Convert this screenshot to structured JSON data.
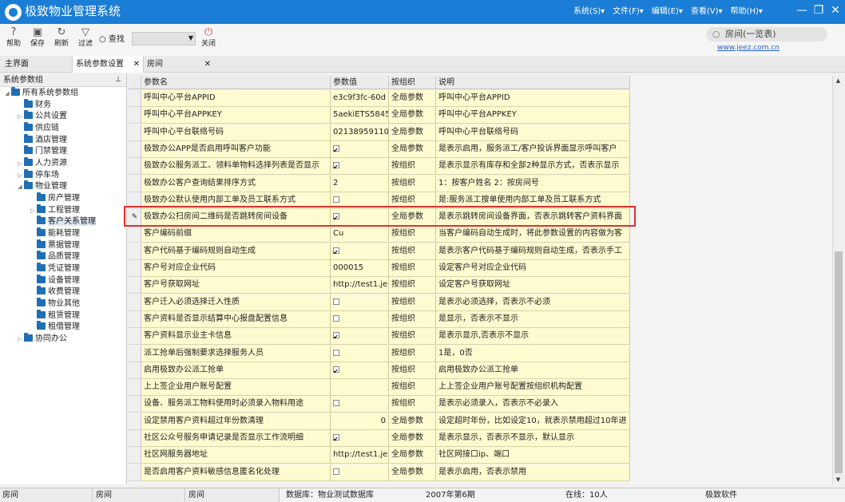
{
  "window": {
    "title": "极致物业管理系统",
    "menu": [
      "系统(S)▾",
      "文件(F)▾",
      "编辑(E)▾",
      "查看(V)▾",
      "帮助(H)▾"
    ]
  },
  "toolbar": {
    "help": "帮助",
    "save": "保存",
    "refresh": "刷新",
    "filter": "过滤",
    "search": "查找",
    "close": "关闭",
    "top_search": "房间(一览表)",
    "site": "www.jeez.com.cn"
  },
  "tabs": {
    "main": "主界面",
    "params": "系统参数设置",
    "room": "房间"
  },
  "tree": {
    "header": "系统参数组",
    "root": "所有系统参数组",
    "items": [
      "财务",
      "公共设置",
      "供应链",
      "酒店管理",
      "门禁管理",
      "人力资源",
      "停车场",
      "物业管理"
    ],
    "sub_items": [
      "房产管理",
      "工程管理",
      "客户关系管理",
      "能耗管理",
      "票据管理",
      "品质管理",
      "凭证管理",
      "设备管理",
      "收费管理",
      "物业其他",
      "租赁管理",
      "租借管理"
    ],
    "last": "协同办公"
  },
  "grid": {
    "headers": [
      "参数名",
      "参数值",
      "按组织",
      "说明"
    ],
    "rows": [
      {
        "name": "呼叫中心平台APPID",
        "value": "e3c9f3fc-60d",
        "check": null,
        "scope": "全局参数",
        "desc": "呼叫中心平台APPID"
      },
      {
        "name": "呼叫中心平台APPKEY",
        "value": "5aekiETS5845",
        "check": null,
        "scope": "全局参数",
        "desc": "呼叫中心平台APPKEY"
      },
      {
        "name": "呼叫中心平台联络号码",
        "value": "02138959110",
        "check": null,
        "scope": "全局参数",
        "desc": "呼叫中心平台联络号码"
      },
      {
        "name": "极致办公APP是否启用呼叫客户功能",
        "value": "",
        "check": true,
        "scope": "全局参数",
        "desc": "是表示启用，服务派工/客户投诉界面显示呼叫客户"
      },
      {
        "name": "极致办公服务派工、领料单物料选择列表是否显示",
        "value": "",
        "check": true,
        "scope": "按组织",
        "desc": "是表示显示有库存和全部2种显示方式，否表示显示"
      },
      {
        "name": "极致办公客户查询结果排序方式",
        "value": "2",
        "check": null,
        "scope": "按组织",
        "desc": "1：按客户姓名 2：按房间号"
      },
      {
        "name": "极致办公默认使用内部工单及员工联系方式",
        "value": "",
        "check": false,
        "scope": "按组织",
        "desc": "是:服务派工搜单使用内部工单及员工联系方式"
      },
      {
        "name": "极致办公扫房间二维码是否跳转房间设备",
        "value": "",
        "check": true,
        "scope": "全局参数",
        "desc": "是表示跳转房间设备界面，否表示跳转客户资料界面"
      },
      {
        "name": "客户编码前缀",
        "value": "Cu",
        "check": null,
        "scope": "按组织",
        "desc": "当客户编码自动生成时，将此参数设置的内容做为客"
      },
      {
        "name": "客户代码基于编码规则自动生成",
        "value": "",
        "check": true,
        "scope": "按组织",
        "desc": "是表示客户代码基于编码规则自动生成，否表示手工"
      },
      {
        "name": "客户号对应企业代码",
        "value": "000015",
        "check": null,
        "scope": "按组织",
        "desc": "设定客户号对应企业代码"
      },
      {
        "name": "客户号获取网址",
        "value": "http://test1.je",
        "check": null,
        "scope": "按组织",
        "desc": "设定客户号获取网址"
      },
      {
        "name": "客户迁入必须选择迁入性质",
        "value": "",
        "check": false,
        "scope": "按组织",
        "desc": "是表示必须选择，否表示不必须"
      },
      {
        "name": "客户资料是否显示结算中心报盘配置信息",
        "value": "",
        "check": false,
        "scope": "按组织",
        "desc": "是显示，否表示不显示"
      },
      {
        "name": "客户资料显示业主卡信息",
        "value": "",
        "check": true,
        "scope": "按组织",
        "desc": "是表示显示,否表示不显示"
      },
      {
        "name": "派工抢单后强制要求选择服务人员",
        "value": "",
        "check": false,
        "scope": "按组织",
        "desc": "1是，0否"
      },
      {
        "name": "启用极致办公派工抢单",
        "value": "",
        "check": true,
        "scope": "按组织",
        "desc": "启用极致办公派工抢单"
      },
      {
        "name": "上上签企业用户账号配置",
        "value": "",
        "check": null,
        "scope": "按组织",
        "desc": "上上签企业用户账号配置按组织机构配置"
      },
      {
        "name": "设备、服务派工物料使用时必须录入物料用途",
        "value": "",
        "check": false,
        "scope": "按组织",
        "desc": "是表示必须录入，否表示不必录入"
      },
      {
        "name": "设定禁用客户资料超过年份数清理",
        "value": "0",
        "check": null,
        "scope": "全局参数",
        "desc": "设定超时年份，比如设定10，就表示禁用超过10年进"
      },
      {
        "name": "社区公众号服务申请记录是否显示工作流明细",
        "value": "",
        "check": true,
        "scope": "全局参数",
        "desc": "是表示显示，否表示不显示，默认显示"
      },
      {
        "name": "社区网服务器地址",
        "value": "http://test1.je",
        "check": null,
        "scope": "全局参数",
        "desc": "社区网接口ip、端口"
      },
      {
        "name": "是否启用客户资料敏感信息匿名化处理",
        "value": "",
        "check": false,
        "scope": "全局参数",
        "desc": "是表示启用，否表示禁用"
      }
    ]
  },
  "status": {
    "s1": "房间",
    "s2": "房间",
    "s3": "房间",
    "db": "数据库：物业测试数据库",
    "period": "2007年第6期",
    "online": "在线：10人",
    "company": "极致软件"
  }
}
